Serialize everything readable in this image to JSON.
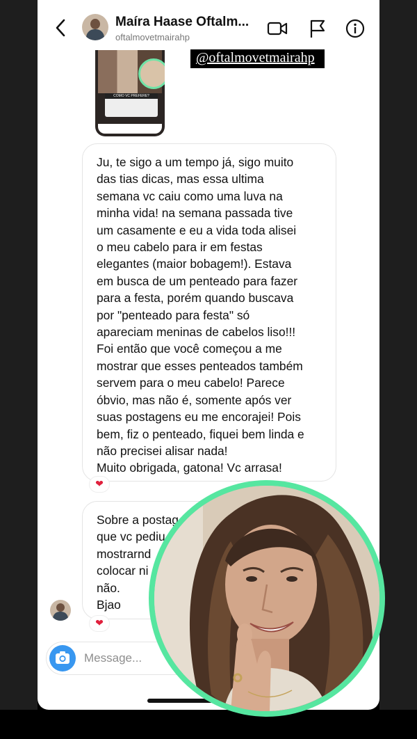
{
  "header": {
    "title": "Maíra Haase Oftalm...",
    "username": "oftalmovetmairahp"
  },
  "shared_post": {
    "thumbnail_caption": "COMO VC PREFERE?",
    "tag": "@oftalmovetmairahp"
  },
  "messages": [
    {
      "text": "Ju, te sigo a um tempo já, sigo muito\ndas tias dicas, mas essa ultima\nsemana vc caiu como uma luva na\nminha vida! na semana passada tive\num casamente  e eu a vida toda alisei\no meu cabelo para ir em festas\nelegantes (maior bobagem!). Estava\nem busca de um penteado para fazer\npara a festa, porém quando buscava\npor \"penteado para festa\" só\napareciam meninas de cabelos liso!!!\nFoi então que você começou a me\nmostrar que esses penteados também\nservem para o meu cabelo! Parece\nóbvio,  mas não é,  somente após ver\nsuas postagens eu me encorajei! Pois\nbem, fiz o penteado, fiquei bem linda e\nnão precisei alisar nada!\nMuito obrigada,  gatona! Vc arrasa!",
      "reaction": "❤"
    },
    {
      "text": "Sobre a postag\nque vc pediu\nmostrarnd\ncolocar ni\nnão.\nBjao",
      "reaction": "❤"
    }
  ],
  "composer": {
    "placeholder": "Message..."
  },
  "icons": [
    "back-chevron-icon",
    "video-call-icon",
    "flag-icon",
    "info-icon",
    "camera-icon",
    "heart-icon"
  ],
  "colors": {
    "camera_button": "#3897f0",
    "video_ring": "#56e6a0",
    "heart": "#e0203c"
  }
}
